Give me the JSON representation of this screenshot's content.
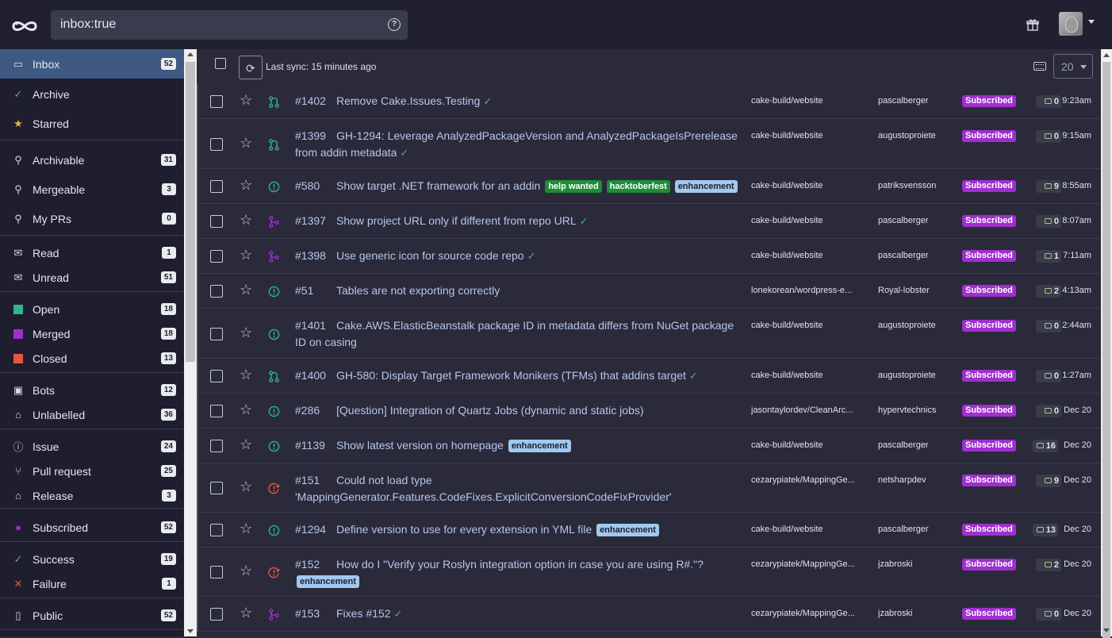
{
  "search": {
    "value": "inbox:true",
    "help_icon": "?"
  },
  "colors": {
    "open": "#2fb58b",
    "merged": "#9e2fcf",
    "closed": "#e3573f",
    "subscribed": "#9f2fcf",
    "active_bg": "#3f5a82"
  },
  "sidebar": {
    "items": [
      {
        "icon": "inbox-icon",
        "glyph": "▭",
        "label": "Inbox",
        "count": "52"
      },
      {
        "icon": "check-icon",
        "glyph": "✓",
        "label": "Archive",
        "count": ""
      },
      {
        "icon": "star-icon",
        "glyph": "★",
        "label": "Starred",
        "count": ""
      },
      {
        "icon": "search-icon",
        "glyph": "⚲",
        "label": "Archivable",
        "count": "31"
      },
      {
        "icon": "search-icon",
        "glyph": "⚲",
        "label": "Mergeable",
        "count": "3"
      },
      {
        "icon": "search-icon",
        "glyph": "⚲",
        "label": "My PRs",
        "count": "0"
      },
      {
        "icon": "envelope-open-icon",
        "glyph": "✉",
        "label": "Read",
        "count": "1"
      },
      {
        "icon": "envelope-icon",
        "glyph": "✉",
        "label": "Unread",
        "count": "51"
      },
      {
        "icon": "square-green-icon",
        "glyph": "",
        "label": "Open",
        "count": "18"
      },
      {
        "icon": "square-purple-icon",
        "glyph": "",
        "label": "Merged",
        "count": "18"
      },
      {
        "icon": "square-red-icon",
        "glyph": "",
        "label": "Closed",
        "count": "13"
      },
      {
        "icon": "robot-icon",
        "glyph": "▣",
        "label": "Bots",
        "count": "12"
      },
      {
        "icon": "tag-icon",
        "glyph": "⌂",
        "label": "Unlabelled",
        "count": "36"
      },
      {
        "icon": "issue-icon",
        "glyph": "ⓘ",
        "label": "Issue",
        "count": "24"
      },
      {
        "icon": "pull-request-icon",
        "glyph": "⑂",
        "label": "Pull request",
        "count": "25"
      },
      {
        "icon": "tag-icon",
        "glyph": "⌂",
        "label": "Release",
        "count": "3"
      },
      {
        "icon": "circle-purple-icon",
        "glyph": "●",
        "label": "Subscribed",
        "count": "52"
      },
      {
        "icon": "check-icon",
        "glyph": "✓",
        "label": "Success",
        "count": "19"
      },
      {
        "icon": "x-icon",
        "glyph": "✕",
        "label": "Failure",
        "count": "1"
      },
      {
        "icon": "book-icon",
        "glyph": "▯",
        "label": "Public",
        "count": "52"
      }
    ]
  },
  "toolbar": {
    "sync_text": "Last sync: 15 minutes ago",
    "per_page": "20",
    "refresh_glyph": "⟳"
  },
  "notifications": [
    {
      "type": "pr-open",
      "number": "#1402",
      "title": "Remove Cake.Issues.Testing",
      "check": true,
      "labels": [],
      "repo": "cake-build/website",
      "author": "pascalberger",
      "badge": "Subscribed",
      "comments": "0",
      "time": "9:23am"
    },
    {
      "type": "pr-open",
      "number": "#1399",
      "title": "GH-1294: Leverage AnalyzedPackageVersion and AnalyzedPackageIsPrerelease from addin metadata",
      "check": true,
      "labels": [],
      "repo": "cake-build/website",
      "author": "augustoproiete",
      "badge": "Subscribed",
      "comments": "0",
      "time": "9:15am"
    },
    {
      "type": "issue-open",
      "number": "#580",
      "title": "Show target .NET framework for an addin",
      "check": false,
      "labels": [
        "help wanted",
        "hacktoberfest",
        "enhancement"
      ],
      "repo": "cake-build/website",
      "author": "patriksvensson",
      "badge": "Subscribed",
      "comments": "9",
      "time": "8:55am"
    },
    {
      "type": "pr-merged",
      "number": "#1397",
      "title": "Show project URL only if different from repo URL",
      "check": true,
      "labels": [],
      "repo": "cake-build/website",
      "author": "pascalberger",
      "badge": "Subscribed",
      "comments": "0",
      "time": "8:07am"
    },
    {
      "type": "pr-merged",
      "number": "#1398",
      "title": "Use generic icon for source code repo",
      "check": true,
      "labels": [],
      "repo": "cake-build/website",
      "author": "pascalberger",
      "badge": "Subscribed",
      "comments": "1",
      "time": "7:11am"
    },
    {
      "type": "issue-open",
      "number": "#51",
      "title": "Tables are not exporting correctly",
      "check": false,
      "labels": [],
      "repo": "lonekorean/wordpress-e...",
      "author": "Royal-lobster",
      "badge": "Subscribed",
      "comments": "2",
      "time": "4:13am"
    },
    {
      "type": "issue-open",
      "number": "#1401",
      "title": "Cake.AWS.ElasticBeanstalk package ID in metadata differs from NuGet package ID on casing",
      "check": false,
      "labels": [],
      "repo": "cake-build/website",
      "author": "augustoproiete",
      "badge": "Subscribed",
      "comments": "0",
      "time": "2:44am"
    },
    {
      "type": "pr-open",
      "number": "#1400",
      "title": "GH-580: Display Target Framework Monikers (TFMs) that addins target",
      "check": true,
      "labels": [],
      "repo": "cake-build/website",
      "author": "augustoproiete",
      "badge": "Subscribed",
      "comments": "0",
      "time": "1:27am"
    },
    {
      "type": "issue-open",
      "number": "#286",
      "title": "[Question] Integration of Quartz Jobs (dynamic and static jobs)",
      "check": false,
      "labels": [],
      "repo": "jasontaylordev/CleanArc...",
      "author": "hypervtechnics",
      "badge": "Subscribed",
      "comments": "0",
      "time": "Dec 20"
    },
    {
      "type": "issue-open",
      "number": "#1139",
      "title": "Show latest version on homepage",
      "check": false,
      "labels": [
        "enhancement"
      ],
      "repo": "cake-build/website",
      "author": "pascalberger",
      "badge": "Subscribed",
      "comments": "16",
      "time": "Dec 20"
    },
    {
      "type": "issue-closed",
      "number": "#151",
      "title": "Could not load type 'MappingGenerator.Features.CodeFixes.ExplicitConversionCodeFixProvider'",
      "check": false,
      "labels": [],
      "repo": "cezarypiatek/MappingGe...",
      "author": "netsharpdev",
      "badge": "Subscribed",
      "comments": "9",
      "time": "Dec 20"
    },
    {
      "type": "issue-open",
      "number": "#1294",
      "title": "Define version to use for every extension in YML file",
      "check": false,
      "labels": [
        "enhancement"
      ],
      "repo": "cake-build/website",
      "author": "pascalberger",
      "badge": "Subscribed",
      "comments": "13",
      "time": "Dec 20"
    },
    {
      "type": "issue-closed",
      "number": "#152",
      "title": "How do I \"Verify your Roslyn integration option in case you are using R#.\"?",
      "check": false,
      "labels": [
        "enhancement"
      ],
      "repo": "cezarypiatek/MappingGe...",
      "author": "jzabroski",
      "badge": "Subscribed",
      "comments": "2",
      "time": "Dec 20"
    },
    {
      "type": "pr-merged",
      "number": "#153",
      "title": "Fixes #152",
      "check": true,
      "labels": [],
      "repo": "cezarypiatek/MappingGe...",
      "author": "jzabroski",
      "badge": "Subscribed",
      "comments": "0",
      "time": "Dec 20"
    }
  ]
}
